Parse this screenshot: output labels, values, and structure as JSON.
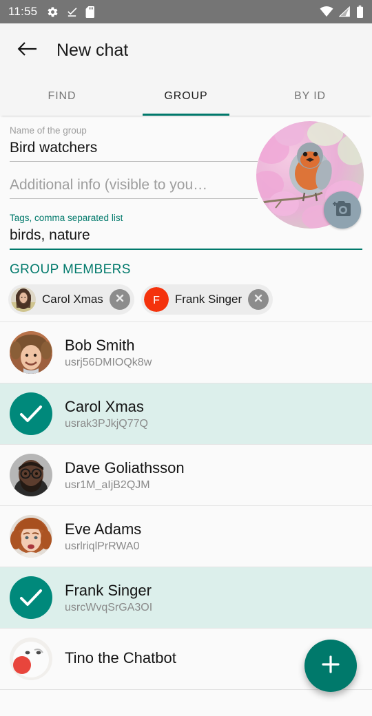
{
  "status_bar": {
    "time": "11:55",
    "left_icons": [
      "gear-icon",
      "download-complete-icon",
      "sd-card-icon"
    ],
    "right_icons": [
      "wifi-icon",
      "cell-signal-icon",
      "battery-icon"
    ],
    "background": "#757575"
  },
  "app_bar": {
    "back_icon": "back-arrow-icon",
    "title": "New chat",
    "background": "#f5f5f5"
  },
  "tabs": {
    "accent": "#00796b",
    "items": [
      {
        "label": "FIND",
        "active": false
      },
      {
        "label": "GROUP",
        "active": true
      },
      {
        "label": "BY ID",
        "active": false
      }
    ]
  },
  "form": {
    "group_name": {
      "label": "Name of the group",
      "value": "Bird watchers"
    },
    "additional_info": {
      "placeholder": "Additional info (visible to you…",
      "value": ""
    },
    "tags": {
      "label": "Tags, comma separated list",
      "value": "birds, nature",
      "focused": true
    },
    "avatar": {
      "name": "group-avatar-image",
      "camera_badge": "camera-icon"
    }
  },
  "group_members": {
    "section_title": "GROUP MEMBERS",
    "accent": "#00796b",
    "chips": [
      {
        "name": "Carol Xmas",
        "avatar_type": "photo",
        "remove_icon": "close-icon"
      },
      {
        "name": "Frank Singer",
        "avatar_type": "initial",
        "initial": "F",
        "initial_color": "#f4320c",
        "remove_icon": "close-icon"
      }
    ]
  },
  "contacts": {
    "selected_color": "#dcefeb",
    "check_color": "#00897b",
    "rows": [
      {
        "name": "Bob Smith",
        "id": "usrj56DMIOQk8w",
        "selected": false,
        "avatar": "photo-bob"
      },
      {
        "name": "Carol Xmas",
        "id": "usrak3PJkjQ77Q",
        "selected": true,
        "avatar": "check-icon"
      },
      {
        "name": "Dave Goliathsson",
        "id": "usr1M_aIjB2QJM",
        "selected": false,
        "avatar": "photo-dave"
      },
      {
        "name": "Eve Adams",
        "id": "usrlriqlPrRWA0",
        "selected": false,
        "avatar": "photo-eve"
      },
      {
        "name": "Frank Singer",
        "id": "usrcWvqSrGA3OI",
        "selected": true,
        "avatar": "check-icon"
      },
      {
        "name": "Tino the Chatbot",
        "id": "",
        "selected": false,
        "avatar": "photo-tino"
      }
    ]
  },
  "fab": {
    "icon": "plus-icon",
    "color": "#00796b"
  }
}
